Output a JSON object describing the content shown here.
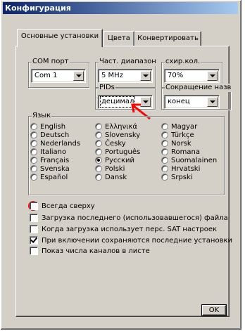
{
  "window": {
    "title": "Конфигурация"
  },
  "tabs": [
    {
      "label": "Основные установки",
      "active": true
    },
    {
      "label": "Цвета",
      "active": false
    },
    {
      "label": "Конвертировать",
      "active": false
    }
  ],
  "com_port": {
    "label": "COM порт",
    "value": "Com 1"
  },
  "freq_range": {
    "label": "Част. диапазон",
    "value": "5 MHz"
  },
  "skhir": {
    "label": "схир.кол.",
    "value": "70%"
  },
  "pids": {
    "label": "PIDs",
    "value": "децимал"
  },
  "abbrev": {
    "label": "Сокращение назв",
    "value": "конец"
  },
  "language": {
    "label": "Язык",
    "selected": "Русский",
    "options": [
      "English",
      "Deutsch",
      "Nederlands",
      "Italiano",
      "Français",
      "Svenska",
      "Español",
      "Ελληνικά",
      "Slovensky",
      "Česky",
      "Português",
      "Русский",
      "Polski",
      "Dansk",
      "Magyar",
      "Türkçe",
      "Norsk",
      "Romana",
      "Suomalainen",
      "Hrvatski",
      "Srpski"
    ]
  },
  "options": [
    {
      "label": "Всегда сверху",
      "checked": false
    },
    {
      "label": "Загрузка последнего (использовавшегося) файла",
      "checked": false
    },
    {
      "label": "Когда загрузка использует перс. SAT настроек",
      "checked": false
    },
    {
      "label": "При включении сохраняются последние установки",
      "checked": true
    },
    {
      "label": "Показ числа каналов  в листе",
      "checked": false
    }
  ],
  "ok_label": "OK",
  "colors": {
    "title_start": "#0a246a",
    "title_end": "#a6caf0",
    "face": "#d4d0c8",
    "annotation": "#ff0000"
  }
}
